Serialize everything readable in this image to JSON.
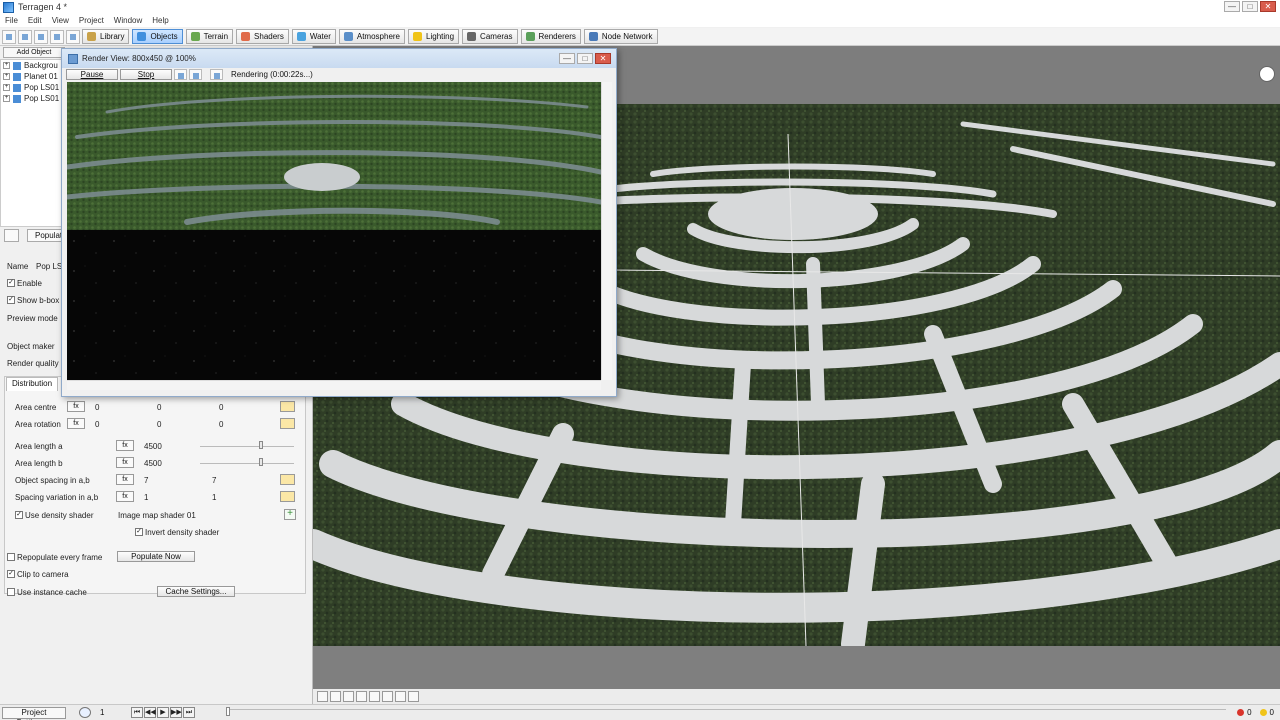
{
  "window": {
    "title": "Terragen 4 *",
    "controls": {
      "minimize": "—",
      "maximize": "□",
      "close": "✕"
    }
  },
  "menu": [
    "File",
    "Edit",
    "View",
    "Project",
    "Window",
    "Help"
  ],
  "toolbar": {
    "tabs": [
      {
        "label": "Library",
        "icon": "library-icon",
        "color": "#c9a24a",
        "active": false
      },
      {
        "label": "Objects",
        "icon": "objects-icon",
        "color": "#3f8fde",
        "active": true
      },
      {
        "label": "Terrain",
        "icon": "terrain-icon",
        "color": "#6aa84f",
        "active": false
      },
      {
        "label": "Shaders",
        "icon": "shaders-icon",
        "color": "#e06b4a",
        "active": false
      },
      {
        "label": "Water",
        "icon": "water-icon",
        "color": "#4aa3df",
        "active": false
      },
      {
        "label": "Atmosphere",
        "icon": "atmosphere-icon",
        "color": "#5b8fc9",
        "active": false
      },
      {
        "label": "Lighting",
        "icon": "lighting-icon",
        "color": "#f0c419",
        "active": false
      },
      {
        "label": "Cameras",
        "icon": "cameras-icon",
        "color": "#666666",
        "active": false
      },
      {
        "label": "Renderers",
        "icon": "renderers-icon",
        "color": "#5aa05a",
        "active": false
      },
      {
        "label": "Node Network",
        "icon": "node-network-icon",
        "color": "#4a7ab8",
        "active": false
      }
    ]
  },
  "left_panel": {
    "add_object": "Add Object",
    "tree": [
      "Backgrou",
      "Planet 01",
      "Pop LS01",
      "Pop LS01"
    ],
    "populate": "Populate",
    "name_label": "Name",
    "name_value": "Pop LS",
    "enable": "Enable",
    "show_bbox": "Show b-box",
    "preview_mode": "Preview mode",
    "object_maker": "Object maker",
    "render_quality": "Render quality",
    "distribution_tab": "Distribution",
    "area_centre": {
      "label": "Area centre",
      "values": [
        "0",
        "0",
        "0"
      ]
    },
    "area_rotation": {
      "label": "Area rotation",
      "values": [
        "0",
        "0",
        "0"
      ]
    },
    "area_length_a": {
      "label": "Area length a",
      "value": "4500"
    },
    "area_length_b": {
      "label": "Area length b",
      "value": "4500"
    },
    "object_spacing": {
      "label": "Object spacing in a,b",
      "values": [
        "7",
        "7"
      ]
    },
    "spacing_variation": {
      "label": "Spacing variation in a,b",
      "values": [
        "1",
        "1"
      ]
    },
    "use_density_shader": "Use density shader",
    "density_shader_value": "Image map shader 01",
    "invert_density_shader": "Invert density shader",
    "repopulate": "Repopulate every frame",
    "populate_now": "Populate Now",
    "clip_to_camera": "Clip to camera",
    "use_instance_cache": "Use instance cache",
    "cache_settings": "Cache Settings..."
  },
  "render_window": {
    "title": "Render View: 800x450 @ 100%",
    "pause": "Pause",
    "stop": "Stop",
    "status": "Rendering  (0:00:22s...)"
  },
  "statusbar": {
    "project_settings": "Project Settings...",
    "frame": "1",
    "transport": [
      "⏮",
      "◀◀",
      "▶",
      "▶▶",
      "⏭"
    ],
    "errors": "0",
    "warnings": "0"
  },
  "colors": {
    "hedge": "#2f3d26",
    "path": "#d7d9da",
    "active_tab": "#a9d0ff"
  }
}
